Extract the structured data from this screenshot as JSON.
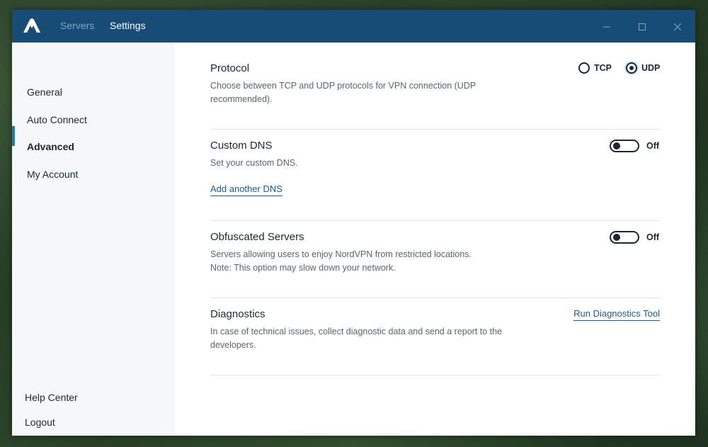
{
  "titlebar": {
    "tabs": [
      {
        "label": "Servers",
        "active": false
      },
      {
        "label": "Settings",
        "active": true
      }
    ]
  },
  "sidebar": {
    "items": [
      {
        "label": "General"
      },
      {
        "label": "Auto Connect"
      },
      {
        "label": "Advanced",
        "active": true
      },
      {
        "label": "My Account"
      }
    ],
    "footer": [
      {
        "label": "Help Center"
      },
      {
        "label": "Logout"
      }
    ]
  },
  "settings": {
    "protocol": {
      "title": "Protocol",
      "description": "Choose between TCP and UDP protocols for VPN connection (UDP recommended).",
      "options": [
        {
          "label": "TCP",
          "checked": false
        },
        {
          "label": "UDP",
          "checked": true
        }
      ]
    },
    "custom_dns": {
      "title": "Custom DNS",
      "description": "Set your custom DNS.",
      "link": "Add another DNS",
      "toggle_label": "Off"
    },
    "obfuscated": {
      "title": "Obfuscated Servers",
      "description_line1": "Servers allowing users to enjoy NordVPN from restricted locations.",
      "description_line2": "Note: This option may slow down your network.",
      "toggle_label": "Off"
    },
    "diagnostics": {
      "title": "Diagnostics",
      "description": "In case of technical issues, collect diagnostic data and send a report to the developers.",
      "link": "Run Diagnostics Tool"
    }
  },
  "colors": {
    "titlebar": "#174c76",
    "accent": "#2b78b8",
    "link": "#1c5a8c"
  }
}
